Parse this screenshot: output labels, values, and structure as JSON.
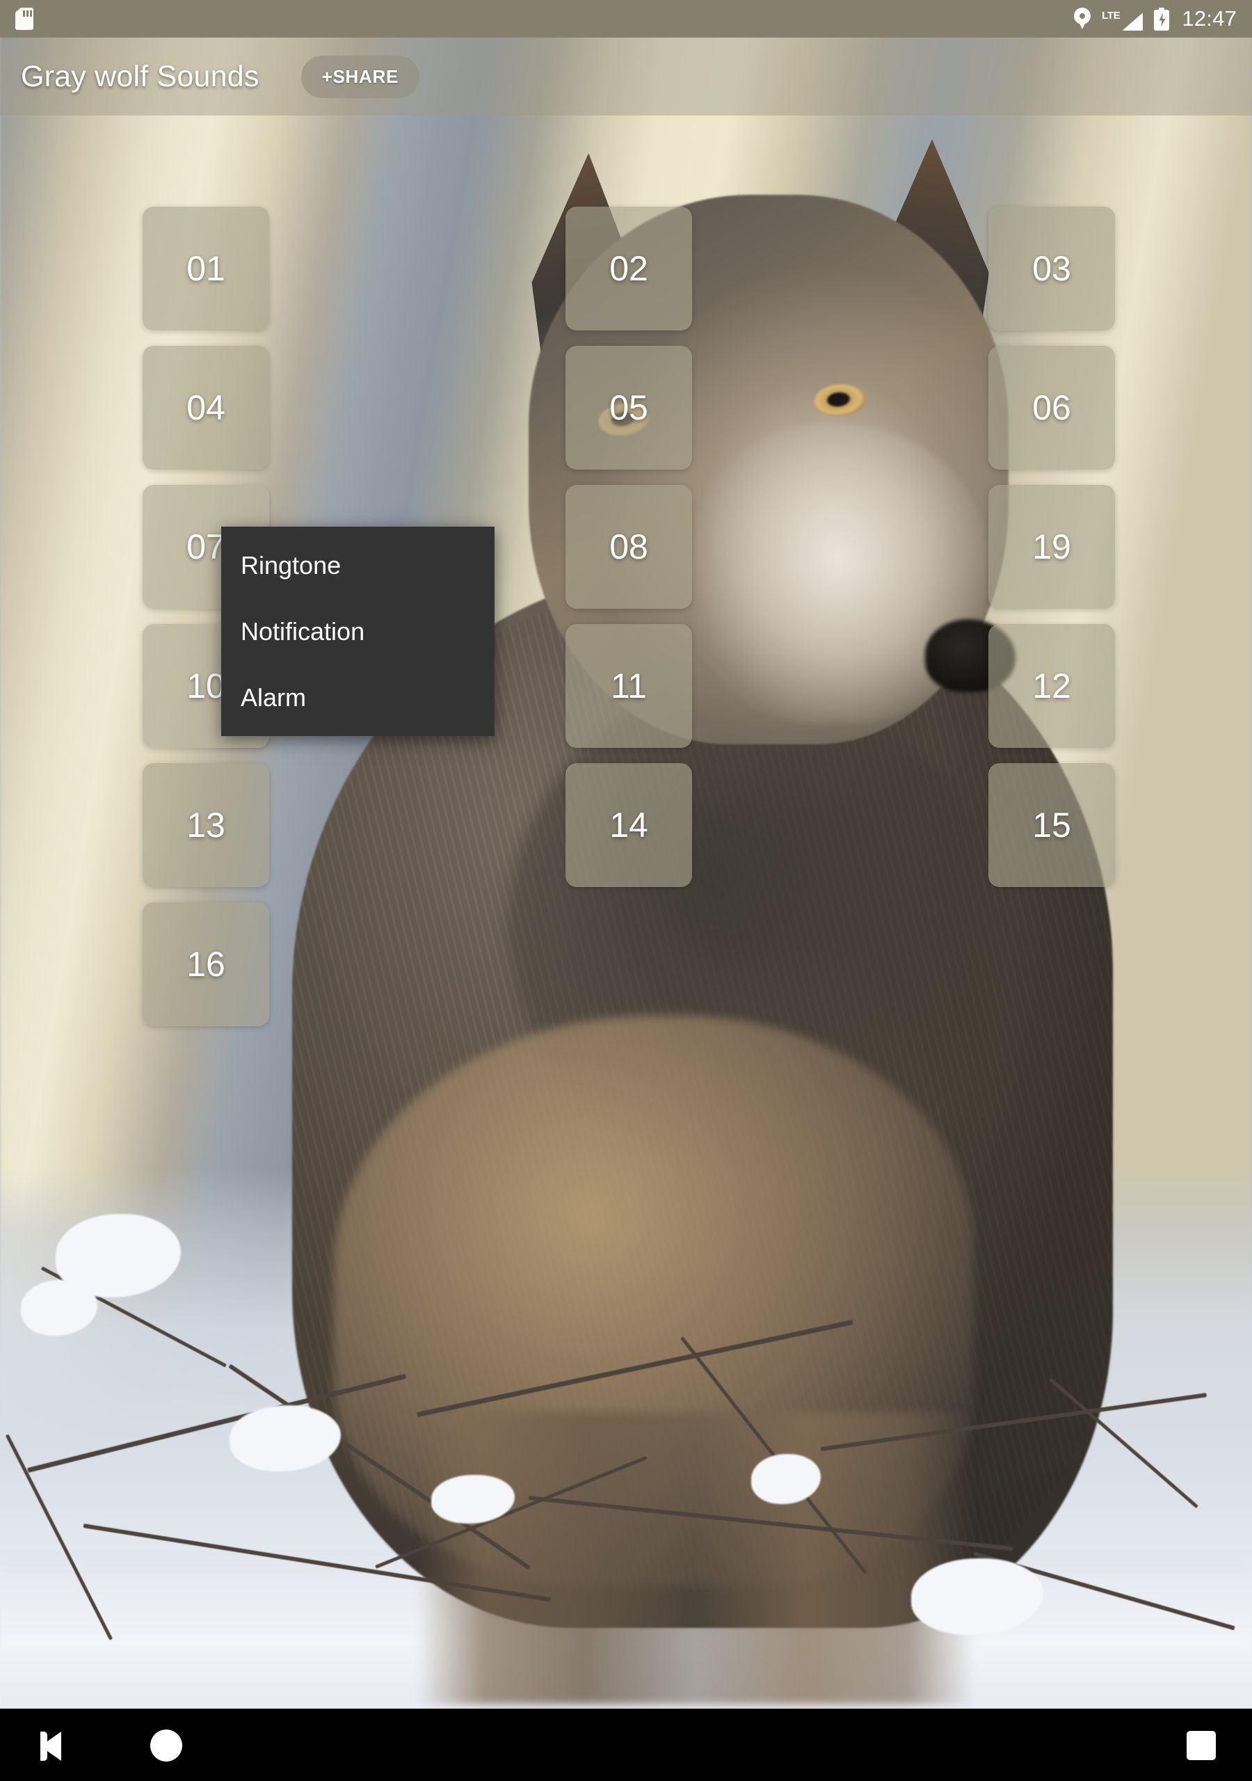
{
  "status_bar": {
    "sd_card_icon": "sd-card-icon",
    "location_icon": "location-pin-icon",
    "network_label": "LTE",
    "signal_icon": "signal-bars-icon",
    "battery_icon": "battery-charging-icon",
    "time": "12:47",
    "background_color": "#857f6d"
  },
  "app_bar": {
    "title": "Gray wolf Sounds",
    "share_label": "+SHARE"
  },
  "sound_grid": {
    "columns": 3,
    "buttons": [
      {
        "label": "01",
        "col": 0,
        "row": 0,
        "pressed": false
      },
      {
        "label": "02",
        "col": 1,
        "row": 0,
        "pressed": false
      },
      {
        "label": "03",
        "col": 2,
        "row": 0,
        "pressed": false
      },
      {
        "label": "04",
        "col": 0,
        "row": 1,
        "pressed": false
      },
      {
        "label": "05",
        "col": 1,
        "row": 1,
        "pressed": false
      },
      {
        "label": "06",
        "col": 2,
        "row": 1,
        "pressed": false
      },
      {
        "label": "07",
        "col": 0,
        "row": 2,
        "pressed": true
      },
      {
        "label": "08",
        "col": 1,
        "row": 2,
        "pressed": false
      },
      {
        "label": "19",
        "col": 2,
        "row": 2,
        "pressed": false
      },
      {
        "label": "10",
        "col": 0,
        "row": 3,
        "pressed": true
      },
      {
        "label": "11",
        "col": 1,
        "row": 3,
        "pressed": false
      },
      {
        "label": "12",
        "col": 2,
        "row": 3,
        "pressed": false
      },
      {
        "label": "13",
        "col": 0,
        "row": 4,
        "pressed": false
      },
      {
        "label": "14",
        "col": 1,
        "row": 4,
        "pressed": false
      },
      {
        "label": "15",
        "col": 2,
        "row": 4,
        "pressed": false
      },
      {
        "label": "16",
        "col": 0,
        "row": 5,
        "pressed": false
      }
    ]
  },
  "context_menu": {
    "visible": true,
    "background_color": "#333333",
    "items": [
      {
        "label": "Ringtone"
      },
      {
        "label": "Notification"
      },
      {
        "label": "Alarm"
      }
    ]
  },
  "nav_bar": {
    "background_color": "#000000",
    "back_icon": "back-triangle-icon",
    "home_icon": "home-circle-icon",
    "recents_icon": "recents-square-icon"
  },
  "wallpaper": {
    "subject": "gray wolf standing in snow",
    "accent_color": "#857f6d"
  }
}
